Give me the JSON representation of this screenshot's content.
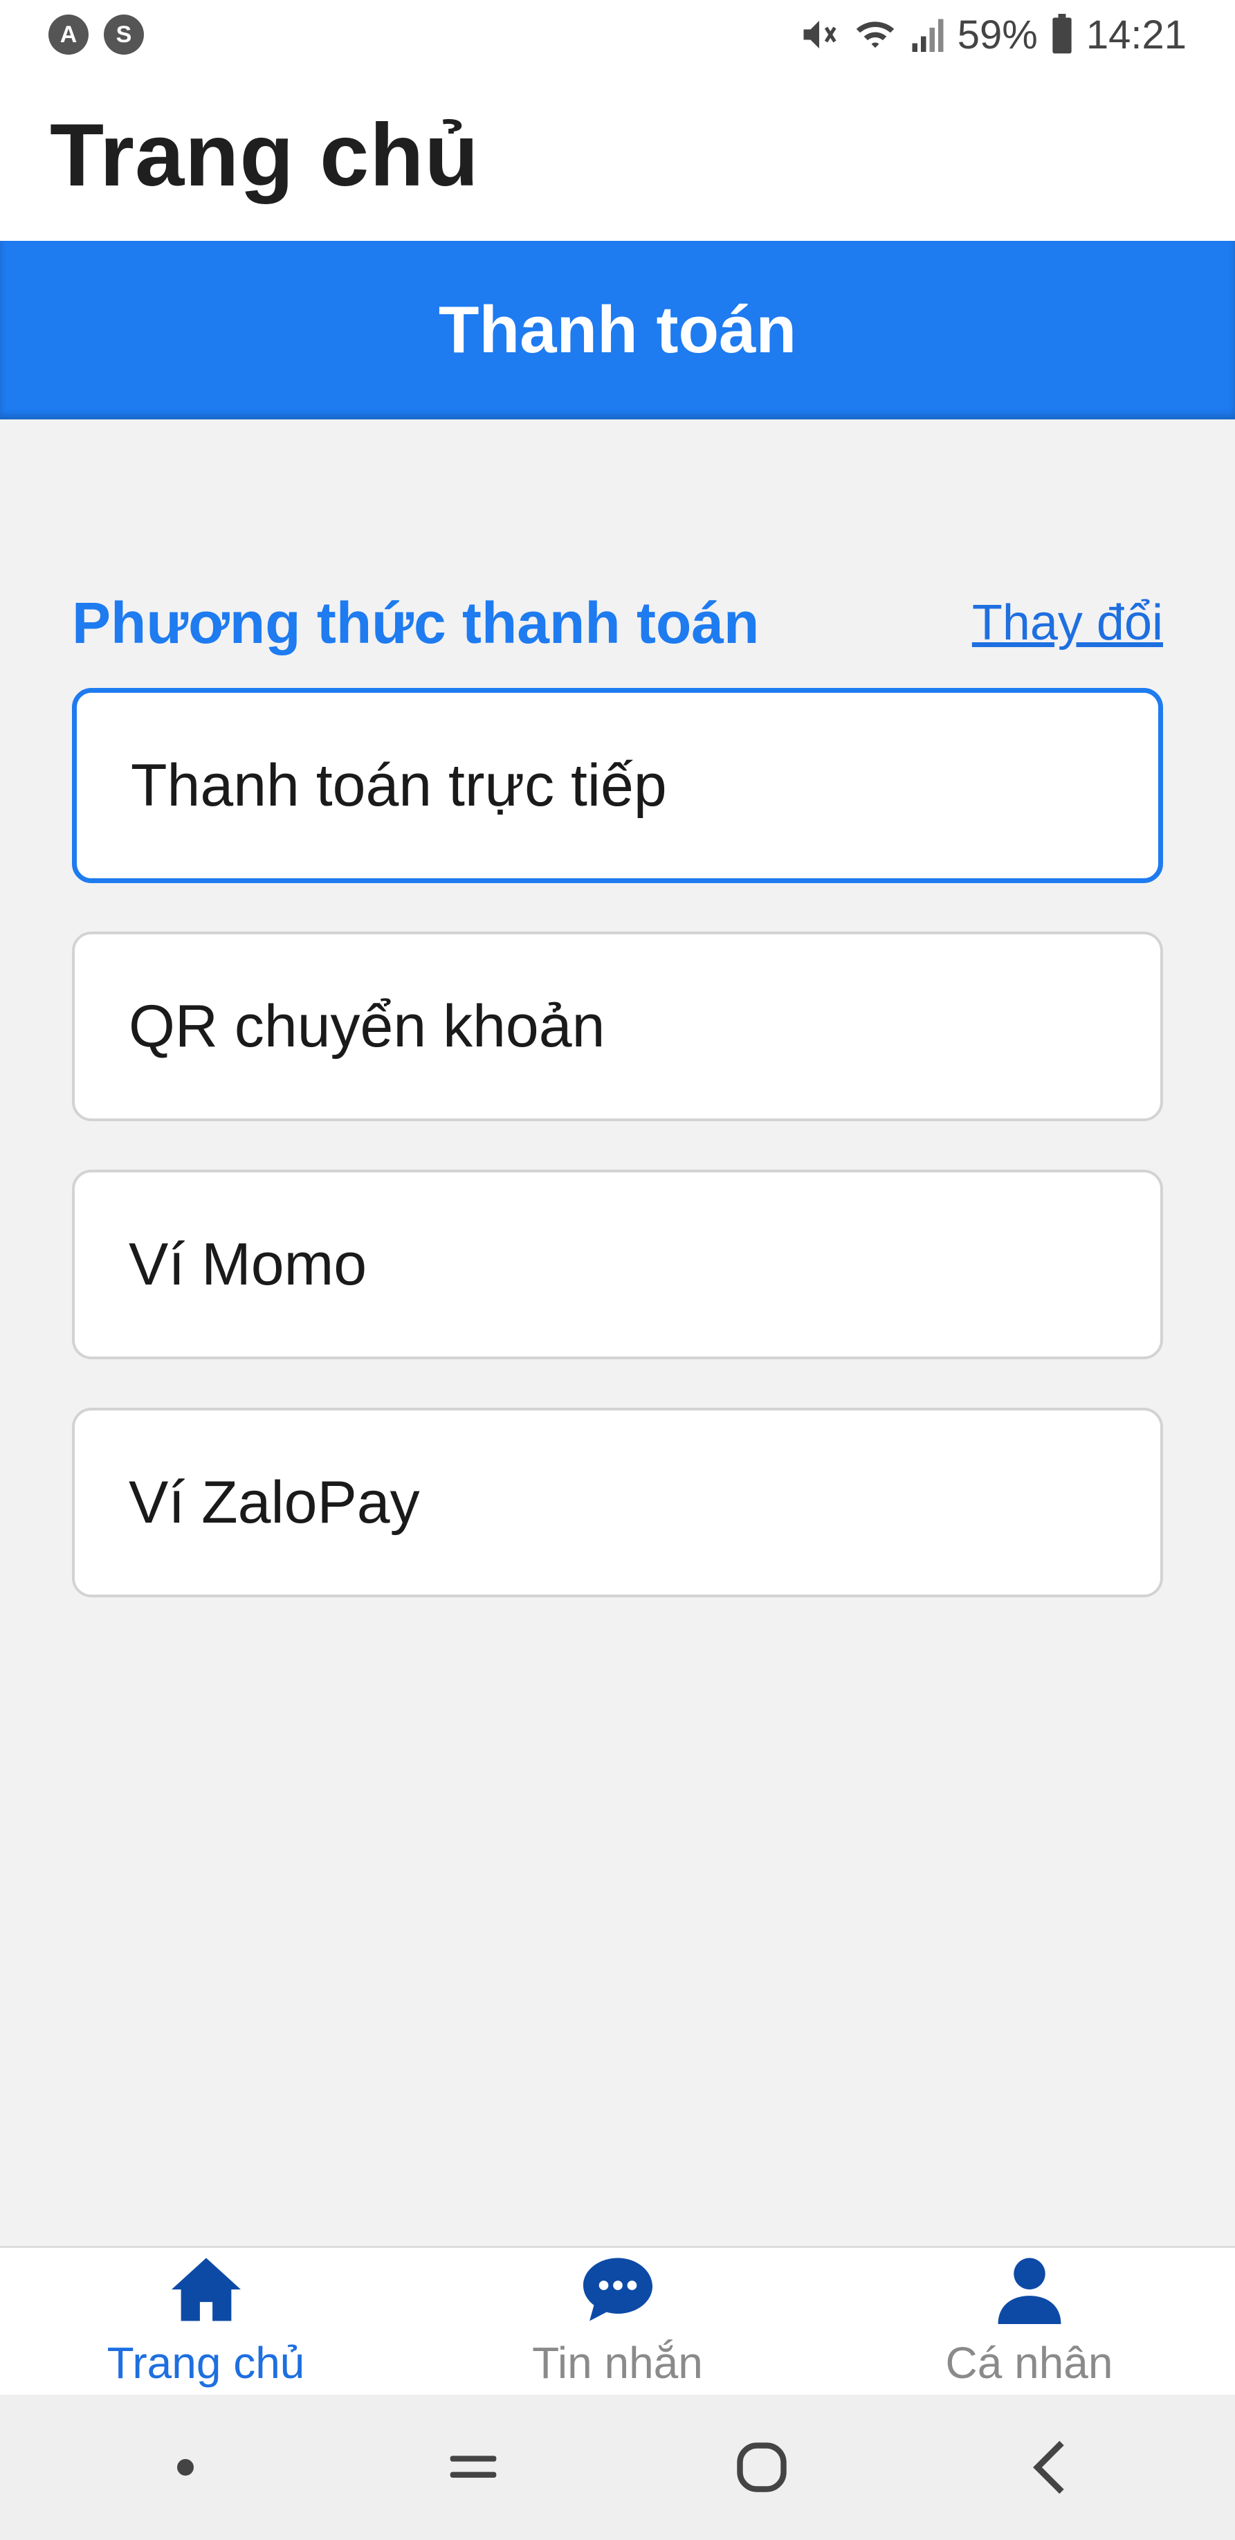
{
  "status_bar": {
    "battery": "59%",
    "time": "14:21",
    "notif_icons": [
      "A",
      "S"
    ]
  },
  "header": {
    "title": "Trang chủ"
  },
  "title_bar": {
    "title": "Thanh toán"
  },
  "payment": {
    "section_title": "Phương thức thanh toán",
    "change_label": "Thay đổi",
    "selected_index": 0,
    "options": [
      {
        "label": "Thanh toán trực tiếp"
      },
      {
        "label": "QR chuyển khoản"
      },
      {
        "label": "Ví Momo"
      },
      {
        "label": "Ví ZaloPay"
      }
    ]
  },
  "bottom_nav": {
    "items": [
      {
        "label": "Trang chủ",
        "icon": "home-icon",
        "active": true
      },
      {
        "label": "Tin nhắn",
        "icon": "chat-icon",
        "active": false
      },
      {
        "label": "Cá nhân",
        "icon": "user-icon",
        "active": false
      }
    ]
  },
  "colors": {
    "primary": "#1e7bf0",
    "nav_active": "#1e6fe0",
    "nav_icon": "#0d4aa6",
    "background": "#f2f2f2"
  }
}
